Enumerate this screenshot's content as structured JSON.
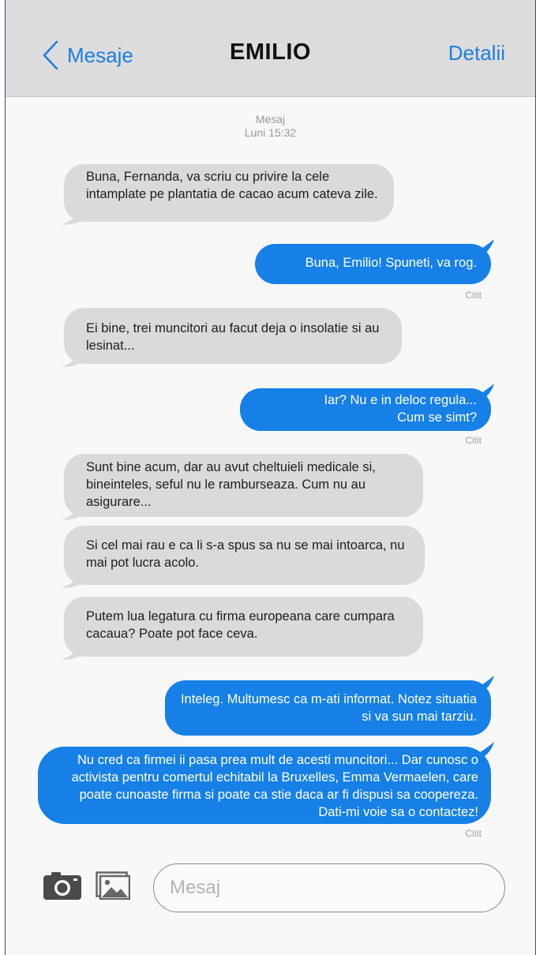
{
  "header": {
    "back_label": "Mesaje",
    "title": "EMILIO",
    "details_label": "Detalii"
  },
  "timestamp": {
    "label": "Mesaj",
    "time": "Luni 15:32"
  },
  "messages": [
    {
      "direction": "in",
      "text": "Buna, Fernanda, va scriu cu privire la cele intamplate pe plantatia de cacao acum cateva zile."
    },
    {
      "direction": "out",
      "text": "Buna, Emilio! Spuneti, va rog.",
      "status": "Citit"
    },
    {
      "direction": "in",
      "text": "Ei bine, trei muncitori au facut deja o insolatie si au lesinat..."
    },
    {
      "direction": "out",
      "text": "Iar? Nu e in deloc regula... Cum se simt?",
      "status": "Citit"
    },
    {
      "direction": "in",
      "text": "Sunt bine acum, dar au avut cheltuieli medicale si, bineinteles, seful nu le ramburseaza. Cum nu au asigurare..."
    },
    {
      "direction": "in",
      "text": "Si cel mai rau e ca li s-a spus sa nu se mai intoarca, nu mai pot lucra acolo."
    },
    {
      "direction": "in",
      "text": "Putem lua legatura cu firma europeana care cumpara cacaua? Poate pot face ceva."
    },
    {
      "direction": "out",
      "text": "Inteleg. Multumesc ca m-ati informat. Notez situatia si va sun mai tarziu."
    },
    {
      "direction": "out",
      "text": "Nu cred ca firmei ii pasa prea mult de acesti muncitori... Dar cunosc o activista pentru comertul echitabil la Bruxelles, Emma Vermaelen, care poate cunoaste firma si poate ca stie daca ar fi dispusi sa coopereza. Dati-mi voie sa o contactez!",
      "status": "Citit"
    }
  ],
  "composer": {
    "placeholder": "Mesaj",
    "camera_icon": "camera-icon",
    "gallery_icon": "image-gallery-icon"
  },
  "colors": {
    "accent": "#1d7fe0",
    "outgoing_bubble": "#1680e6",
    "incoming_bubble": "#dadada",
    "header_bg": "#dcdcdc"
  }
}
